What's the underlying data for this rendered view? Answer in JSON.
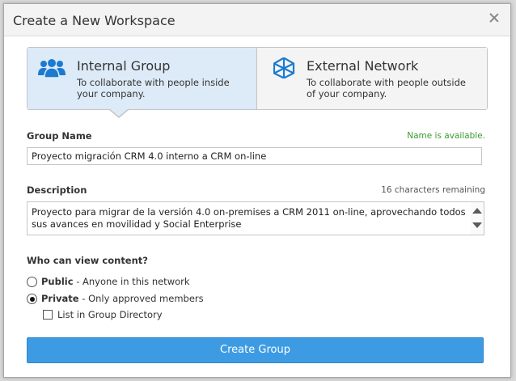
{
  "dialog": {
    "title": "Create a New Workspace"
  },
  "workspace_types": [
    {
      "title": "Internal Group",
      "description": "To collaborate with people inside your company.",
      "icon": "people-group-icon",
      "selected": true
    },
    {
      "title": "External Network",
      "description": "To collaborate with people outside of your company.",
      "icon": "network-icon",
      "selected": false
    }
  ],
  "form": {
    "group_name_label": "Group Name",
    "group_name_status": "Name is available.",
    "group_name_value": "Proyecto migración CRM 4.0 interno a CRM on-line",
    "description_label": "Description",
    "description_counter": "16 characters remaining",
    "description_value": "Proyecto para migrar de la versión 4.0 on-premises a CRM 2011 on-line, aprovechando todos sus avances en movilidad y Social Enterprise",
    "visibility_label": "Who can view content?",
    "visibility_options": [
      {
        "name": "Public",
        "detail": " - Anyone in this network",
        "checked": false
      },
      {
        "name": "Private",
        "detail": " - Only approved members",
        "checked": true
      }
    ],
    "directory_label": "List in Group Directory",
    "directory_checked": false
  },
  "actions": {
    "create_label": "Create Group"
  },
  "colors": {
    "accent": "#3d9be3",
    "selected_tab": "#ddeaf7",
    "icon_blue": "#1a7bd0",
    "status_ok": "#3b9a2f"
  }
}
